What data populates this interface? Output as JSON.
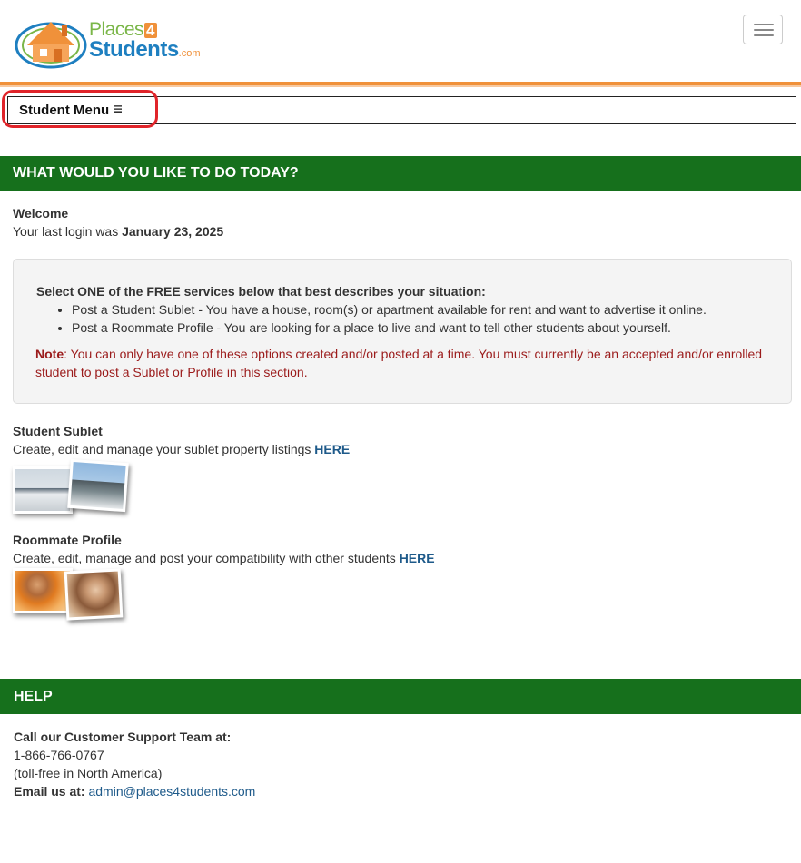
{
  "header": {
    "logo": {
      "places": "Places",
      "four": "4",
      "students": "Students",
      "com": ".com"
    },
    "menu_icon": "hamburger-menu-icon"
  },
  "student_menu": {
    "label": "Student Menu",
    "icon": "≡"
  },
  "section_today": {
    "title": "WHAT WOULD YOU LIKE TO DO TODAY?"
  },
  "welcome": {
    "heading": "Welcome",
    "last_login_prefix": "Your last login was ",
    "last_login_date": "January 23, 2025"
  },
  "info": {
    "heading": "Select ONE of the FREE services below that best describes your situation:",
    "items": [
      "Post a Student Sublet - You have a house, room(s) or apartment available for rent and want to advertise it online.",
      "Post a Roommate Profile - You are looking for a place to live and want to tell other students about yourself."
    ],
    "note_label": "Note",
    "note_text": ": You can only have one of these options created and/or posted at a time. You must currently be an accepted and/or enrolled student to post a Sublet or Profile in this section."
  },
  "sublet": {
    "heading": "Student Sublet",
    "text": "Create, edit and manage your sublet property listings ",
    "link": "HERE"
  },
  "roommate": {
    "heading": "Roommate Profile",
    "text": "Create, edit, manage and post your compatibility with other students ",
    "link": "HERE"
  },
  "help": {
    "title": "HELP",
    "call_label": "Call our Customer Support Team at:",
    "phone": "1-866-766-0767",
    "phone_note": "(toll-free in North America)",
    "email_label": "Email us at:",
    "email": "admin@places4students.com"
  },
  "colors": {
    "section_green": "#16701c",
    "accent_orange": "#f0913a",
    "link_blue": "#1e5a8a",
    "note_red": "#9b1b1b",
    "highlight_red": "#e0242a"
  }
}
